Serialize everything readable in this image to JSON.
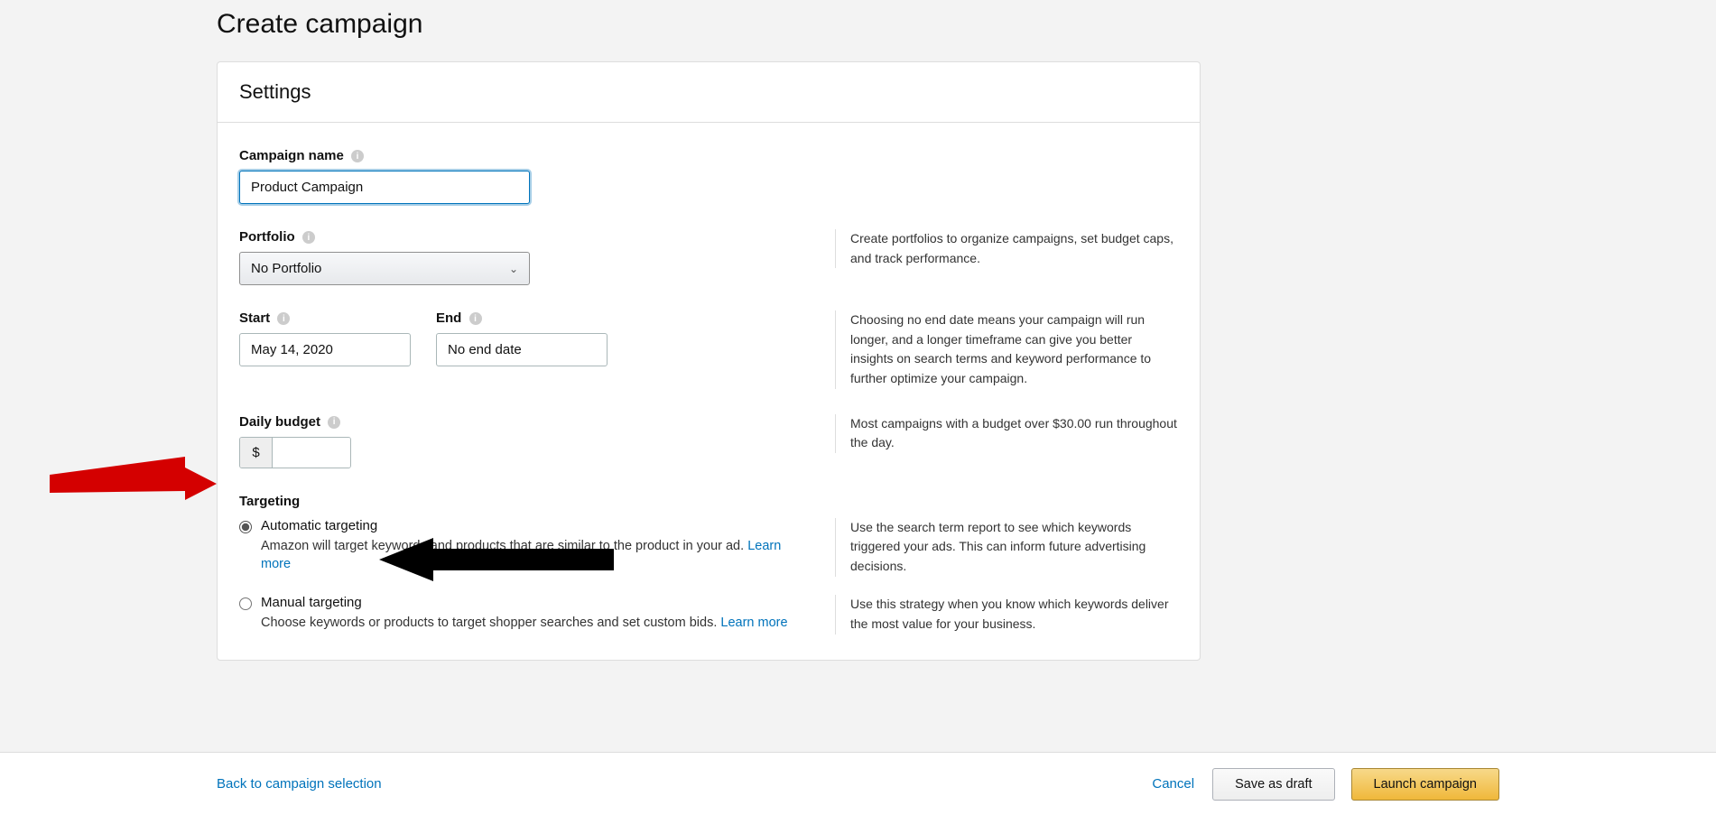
{
  "pageTitle": "Create campaign",
  "settings": {
    "heading": "Settings",
    "campaignName": {
      "label": "Campaign name",
      "value": "Product Campaign"
    },
    "portfolio": {
      "label": "Portfolio",
      "selected": "No Portfolio",
      "help": "Create portfolios to organize campaigns, set budget caps, and track performance."
    },
    "dates": {
      "startLabel": "Start",
      "endLabel": "End",
      "startValue": "May 14, 2020",
      "endValue": "No end date",
      "help": "Choosing no end date means your campaign will run longer, and a longer timeframe can give you better insights on search terms and keyword performance to further optimize your campaign."
    },
    "budget": {
      "label": "Daily budget",
      "currency": "$",
      "value": "",
      "help": "Most campaigns with a budget over $30.00 run throughout the day."
    },
    "targeting": {
      "label": "Targeting",
      "auto": {
        "title": "Automatic targeting",
        "desc": "Amazon will target keywords and products that are similar to the product in your ad.  ",
        "learnMore": "Learn more",
        "help": "Use the search term report to see which keywords triggered your ads. This can inform future advertising decisions."
      },
      "manual": {
        "title": "Manual targeting",
        "desc": "Choose keywords or products to target shopper searches and set custom bids. ",
        "learnMore": "Learn more",
        "help": "Use this strategy when you know which keywords deliver the most value for your business."
      }
    }
  },
  "footer": {
    "back": "Back to campaign selection",
    "cancel": "Cancel",
    "saveDraft": "Save as draft",
    "launch": "Launch campaign"
  }
}
